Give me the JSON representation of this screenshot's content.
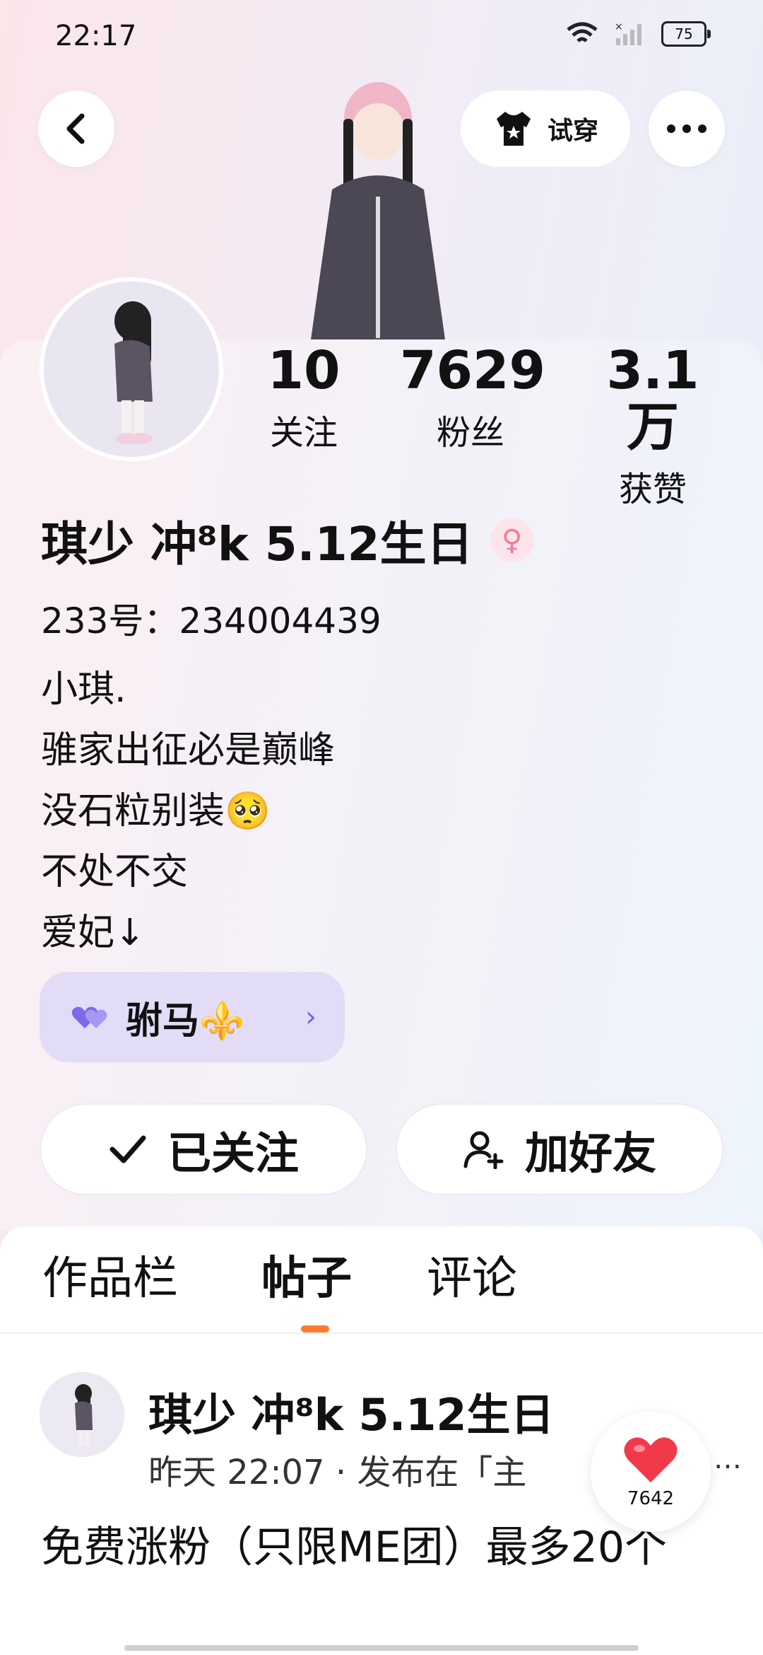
{
  "status_bar": {
    "time": "22:17",
    "battery": "75"
  },
  "header": {
    "tryon_label": "试穿"
  },
  "stats": [
    {
      "value": "10",
      "label": "关注"
    },
    {
      "value": "7629",
      "label": "粉丝"
    },
    {
      "value": "3.1万",
      "label": "获赞"
    }
  ],
  "profile": {
    "name": "琪少 冲⁸k 5.12生日",
    "uid": "233号：234004439",
    "bio": [
      "小琪.",
      "骓家出征必是巅峰",
      "没石粒别装🥺",
      "不处不交",
      "爱妃↓"
    ],
    "tag": "驸马⚜️"
  },
  "actions": {
    "followed_label": "已关注",
    "add_friend_label": "加好友"
  },
  "tabs": [
    "作品栏",
    "帖子",
    "评论"
  ],
  "post": {
    "author": "琪少 冲⁸k 5.12生日",
    "meta": "昨天 22:07 · 发布在「主",
    "more": "…",
    "text": "免费涨粉（只限ME团）最多20个",
    "likes": "7642"
  },
  "colors": {
    "accent": "#ff7a2e",
    "tag_bg": "#e3dcf7",
    "heart": "#f2394a"
  }
}
